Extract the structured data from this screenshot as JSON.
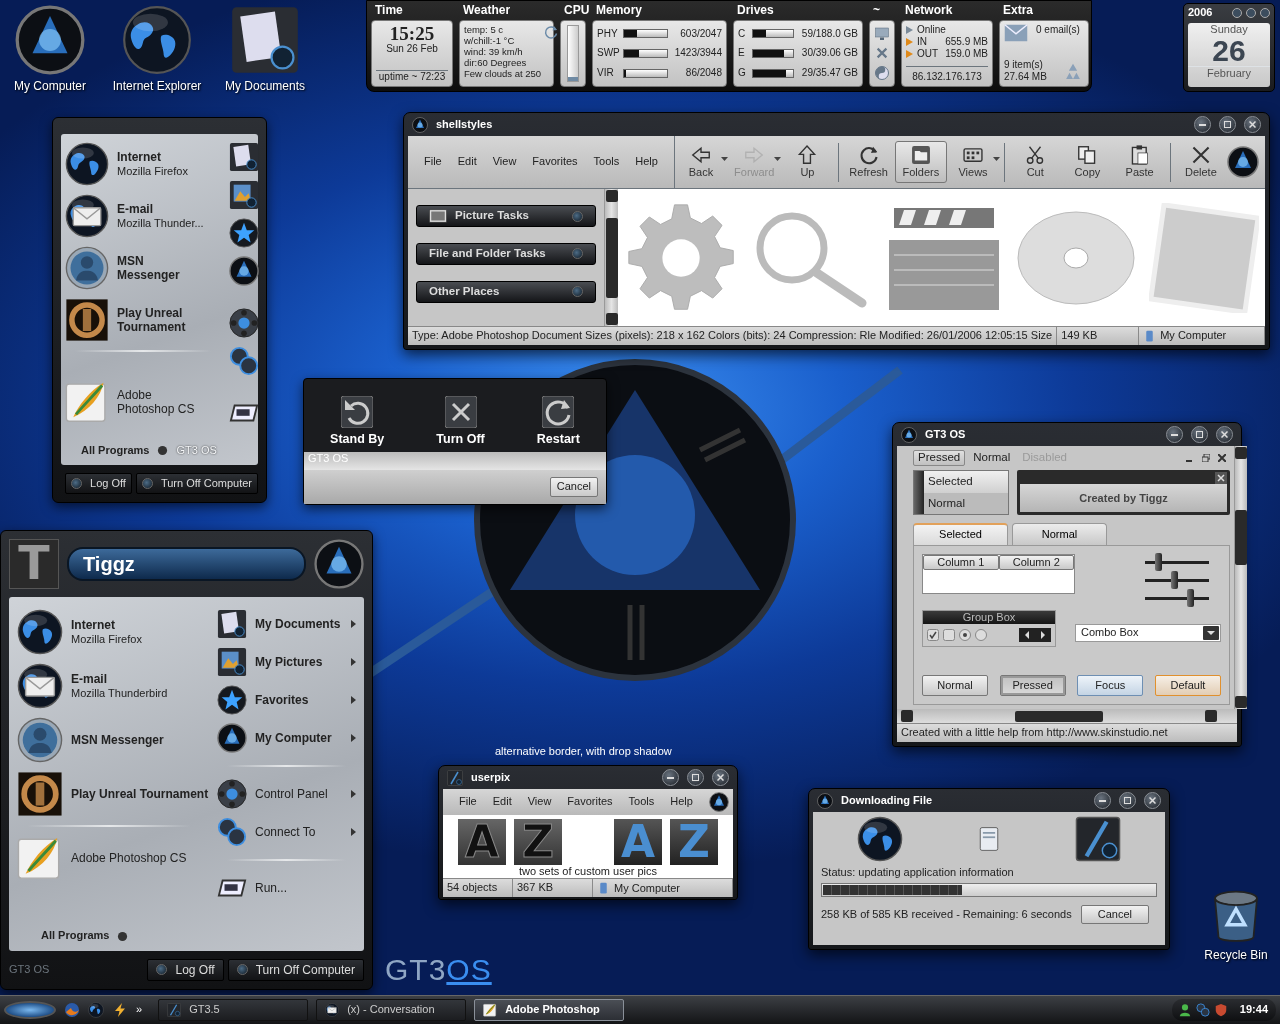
{
  "desktop_icons": [
    {
      "label": "My Computer"
    },
    {
      "label": "Internet Explorer"
    },
    {
      "label": "My Documents"
    },
    {
      "label": "Recycle Bin"
    }
  ],
  "widget_bar": {
    "sections": [
      "Time",
      "Weather",
      "CPU",
      "Memory",
      "Drives",
      "~",
      "Network",
      "Extra"
    ],
    "time": {
      "clock": "15:25",
      "date": "Sun 26 Feb",
      "uptime": "uptime ~ 72:23"
    },
    "weather": {
      "lines": [
        "temp: 5 c",
        "w/chill:-1 °C",
        "wind: 39 km/h",
        "dir:60 Degrees",
        "Few clouds at 250"
      ]
    },
    "cpu": {
      "level": 0.08
    },
    "memory": [
      {
        "label": "PHY",
        "level": 0.3,
        "reading": "603/2047"
      },
      {
        "label": "SWP",
        "level": 0.36,
        "reading": "1423/3944"
      },
      {
        "label": "VIR",
        "level": 0.05,
        "reading": "86/2048"
      }
    ],
    "drives": [
      {
        "label": "C",
        "level": 0.33,
        "reading": "59/188.0 GB"
      },
      {
        "label": "E",
        "level": 0.77,
        "reading": "30/39.06 GB"
      },
      {
        "label": "G",
        "level": 0.83,
        "reading": "29/35.47 GB"
      }
    ],
    "network": {
      "status": "Online",
      "rows": [
        {
          "label": "IN",
          "value": "655.9 MB"
        },
        {
          "label": "OUT",
          "value": "159.0 MB"
        }
      ],
      "ip": "86.132.176.173"
    },
    "extra": {
      "email": "0 email(s)",
      "bin_items": "9 item(s)",
      "bin_size": "27.64 MB"
    }
  },
  "calendar": {
    "year": "2006",
    "weekday": "Sunday",
    "day": "26",
    "month": "February"
  },
  "shellstyles": {
    "title": "shellstyles",
    "menu": [
      "File",
      "Edit",
      "View",
      "Favorites",
      "Tools",
      "Help"
    ],
    "toolbar": [
      {
        "label": "Back",
        "selected": false,
        "disabled": false,
        "dropdown": true
      },
      {
        "label": "Forward",
        "selected": false,
        "disabled": true,
        "dropdown": true
      },
      {
        "label": "Up",
        "selected": false,
        "disabled": false,
        "dropdown": false
      },
      {
        "label": "Refresh",
        "selected": false,
        "disabled": false,
        "dropdown": false
      },
      {
        "label": "Folders",
        "selected": true,
        "disabled": false,
        "dropdown": false
      },
      {
        "label": "Views",
        "selected": false,
        "disabled": false,
        "dropdown": true
      },
      {
        "label": "Cut",
        "selected": false,
        "disabled": false,
        "dropdown": false
      },
      {
        "label": "Copy",
        "selected": false,
        "disabled": false,
        "dropdown": false
      },
      {
        "label": "Paste",
        "selected": false,
        "disabled": false,
        "dropdown": false
      },
      {
        "label": "Delete",
        "selected": false,
        "disabled": false,
        "dropdown": false
      }
    ],
    "tasks": [
      "Picture Tasks",
      "File and Folder Tasks",
      "Other Places"
    ],
    "status": [
      "Type: Adobe Photoshop Document Sizes (pixels): 218 x 162 Colors (bits): 24 Compression: Rle Modified: 26/01/2006 12:05:15 Size",
      "149 KB",
      "My Computer"
    ]
  },
  "small_start": {
    "groups": [
      [
        {
          "title": "Internet",
          "subtitle": "Mozilla Firefox",
          "bold": true
        },
        {
          "title": "E-mail",
          "subtitle": "Mozilla Thunder...",
          "bold": true
        },
        {
          "title": "MSN Messenger",
          "bold": true
        },
        {
          "title": "Play Unreal Tournament",
          "bold": true
        }
      ],
      [
        {
          "title": "Adobe Photoshop CS",
          "bold": false
        }
      ]
    ],
    "all_programs": "All Programs",
    "brand": "GT3 OS",
    "buttons": [
      "Log Off",
      "Turn Off Computer"
    ]
  },
  "shutdown": {
    "buttons": [
      "Stand By",
      "Turn Off",
      "Restart"
    ],
    "brand": "GT3 OS",
    "cancel": "Cancel"
  },
  "big_start": {
    "user_pic": "T",
    "user": "Tiggz",
    "left": [
      [
        {
          "title": "Internet",
          "subtitle": "Mozilla Firefox",
          "bold": true
        },
        {
          "title": "E-mail",
          "subtitle": "Mozilla Thunderbird",
          "bold": true
        },
        {
          "title": "MSN Messenger",
          "bold": true
        },
        {
          "title": "Play Unreal Tournament",
          "bold": true
        }
      ],
      [
        {
          "title": "Adobe Photoshop CS",
          "bold": false
        }
      ]
    ],
    "right": [
      [
        {
          "label": "My Documents",
          "bold": true,
          "submenu": true
        },
        {
          "label": "My Pictures",
          "bold": true,
          "submenu": true
        },
        {
          "label": "Favorites",
          "bold": true,
          "submenu": true
        },
        {
          "label": "My Computer",
          "bold": true,
          "submenu": true
        }
      ],
      [
        {
          "label": "Control Panel",
          "bold": false,
          "submenu": true
        },
        {
          "label": "Connect To",
          "bold": false,
          "submenu": true
        }
      ],
      [
        {
          "label": "Run...",
          "bold": false,
          "submenu": false
        }
      ]
    ],
    "all_programs": "All Programs",
    "brand": "GT3 OS",
    "buttons": [
      "Log Off",
      "Turn Off Computer"
    ]
  },
  "logo": {
    "text": "GT3",
    "accent": "OS"
  },
  "gt3_window": {
    "title": "GT3 OS",
    "menu": [
      {
        "label": "Pressed",
        "selected": true,
        "disabled": false
      },
      {
        "label": "Normal",
        "selected": false,
        "disabled": false
      },
      {
        "label": "Disabled",
        "selected": false,
        "disabled": true
      }
    ],
    "list": [
      {
        "label": "Selected",
        "selected": true
      },
      {
        "label": "Normal",
        "selected": false
      }
    ],
    "panel_title": "Created by Tiggz",
    "tabs": [
      {
        "label": "Selected",
        "selected": true
      },
      {
        "label": "Normal",
        "selected": false
      }
    ],
    "columns": [
      "Column 1",
      "Column 2"
    ],
    "sliders": [
      {
        "level": 0.2
      },
      {
        "level": 0.45
      },
      {
        "level": 0.7
      }
    ],
    "group_box": {
      "title": "Group Box",
      "checkboxes": [
        {
          "checked": true
        },
        {
          "checked": false
        }
      ],
      "radios": [
        {
          "selected": true
        },
        {
          "selected": false
        }
      ]
    },
    "combo": "Combo Box",
    "buttons": [
      {
        "label": "Normal",
        "kind": "normal"
      },
      {
        "label": "Pressed",
        "kind": "pressed"
      },
      {
        "label": "Focus",
        "kind": "focus"
      },
      {
        "label": "Default",
        "kind": "default"
      }
    ],
    "status": "Created with a little help from http://www.skinstudio.net"
  },
  "userpix": {
    "caption": "alternative border, with drop shadow",
    "title": "userpix",
    "menu": [
      "File",
      "Edit",
      "View",
      "Favorites",
      "Tools",
      "Help"
    ],
    "pics": [
      {
        "letter": "A",
        "kind": "dark"
      },
      {
        "letter": "Z",
        "kind": "dark"
      },
      {
        "letter": "A",
        "kind": "blue"
      },
      {
        "letter": "Z",
        "kind": "blue"
      }
    ],
    "pics_caption": "two sets of custom user pics",
    "status": [
      "54 objects",
      "367 KB",
      "My Computer"
    ]
  },
  "download": {
    "title": "Downloading File",
    "status": "Status: updating application information",
    "progress": {
      "level": 0.42
    },
    "detail": "258 KB of 585 KB received - Remaining: 6 seconds",
    "cancel": "Cancel"
  },
  "taskbar": {
    "overflow": "»",
    "tasks": [
      {
        "label": "GT3.5",
        "selected": false
      },
      {
        "label": "(x) - Conversation",
        "selected": false
      },
      {
        "label": "Adobe Photoshop",
        "selected": true
      }
    ],
    "clock": "19:44"
  }
}
